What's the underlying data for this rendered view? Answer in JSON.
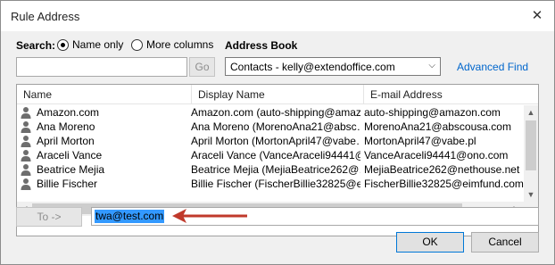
{
  "window": {
    "title": "Rule Address"
  },
  "search": {
    "label": "Search:",
    "options": [
      {
        "label": "Name only",
        "selected": true
      },
      {
        "label": "More columns",
        "selected": false
      }
    ],
    "input_value": "",
    "go_label": "Go"
  },
  "address_book": {
    "label": "Address Book",
    "selected": "Contacts - kelly@extendoffice.com",
    "advanced_find": "Advanced Find"
  },
  "table": {
    "columns": [
      "Name",
      "Display Name",
      "E-mail Address"
    ],
    "rows": [
      {
        "name": "Amazon.com",
        "display": "Amazon.com (auto-shipping@amaz…",
        "email": "auto-shipping@amazon.com"
      },
      {
        "name": "Ana Moreno",
        "display": "Ana Moreno (MorenoAna21@absc…",
        "email": "MorenoAna21@abscousa.com"
      },
      {
        "name": "April Morton",
        "display": "April Morton (MortonApril47@vabe…",
        "email": "MortonApril47@vabe.pl"
      },
      {
        "name": "Araceli Vance",
        "display": "Araceli Vance (VanceAraceli94441@…",
        "email": "VanceAraceli94441@ono.com"
      },
      {
        "name": "Beatrice Mejia",
        "display": "Beatrice Mejia (MejiaBeatrice262@…",
        "email": "MejiaBeatrice262@nethouse.net"
      },
      {
        "name": "Billie Fischer",
        "display": "Billie Fischer (FischerBillie32825@ei…",
        "email": "FischerBillie32825@eimfund.com"
      }
    ]
  },
  "to": {
    "button_label": "To ->",
    "value": "twa@test.com"
  },
  "footer": {
    "ok_label": "OK",
    "cancel_label": "Cancel"
  },
  "colors": {
    "selection": "#3399ff",
    "link": "#0066cc",
    "annotation_arrow": "#c0392b"
  }
}
